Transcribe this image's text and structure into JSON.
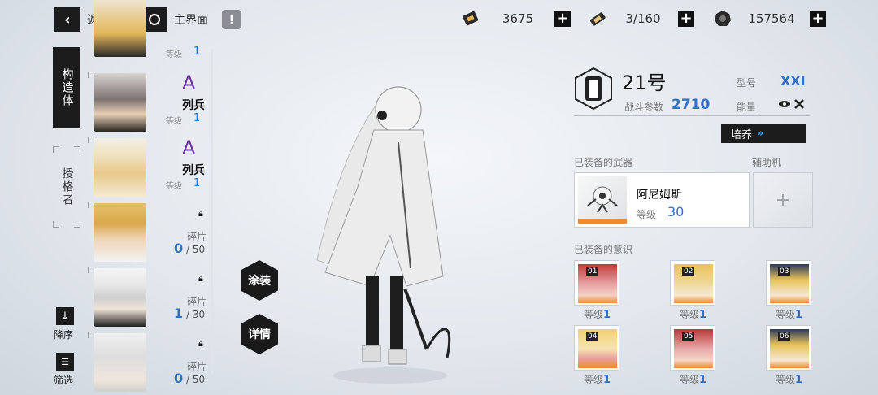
{
  "topbar": {
    "back_label": "返回",
    "main_label": "主界面",
    "info_glyph": "!"
  },
  "resources": [
    {
      "icon": "gold-bar-icon",
      "value": "3675"
    },
    {
      "icon": "stamina-battery-icon",
      "value": "3/160"
    },
    {
      "icon": "cog-coin-icon",
      "value": "157564"
    }
  ],
  "tabs": [
    {
      "label": "构造体",
      "active": true
    },
    {
      "label": "授格者",
      "active": false
    }
  ],
  "characters": [
    {
      "level_label": "等级",
      "level": "1",
      "rank": "",
      "class": "",
      "state": "owned"
    },
    {
      "level_label": "等级",
      "level": "1",
      "rank": "A",
      "class": "列兵",
      "state": "owned"
    },
    {
      "level_label": "等级",
      "level": "1",
      "rank": "A",
      "class": "列兵",
      "state": "owned"
    },
    {
      "shard_label": "碎片",
      "have": "0",
      "need": "50",
      "state": "locked"
    },
    {
      "shard_label": "碎片",
      "have": "1",
      "need": "30",
      "state": "locked"
    },
    {
      "shard_label": "碎片",
      "have": "0",
      "need": "50",
      "state": "locked"
    }
  ],
  "list_controls": {
    "sort_label": "降序",
    "filter_label": "筛选"
  },
  "side_buttons": {
    "coating_label": "涂装",
    "detail_label": "详情"
  },
  "unit": {
    "name": "21号",
    "power_label": "战斗参数",
    "power": "2710",
    "model_label": "型号",
    "model": "XXI",
    "energy_label": "能量",
    "train_label": "培养"
  },
  "weapon": {
    "section_label": "已装备的武器",
    "name": "阿尼姆斯",
    "level_label": "等级",
    "level": "30"
  },
  "support": {
    "section_label": "辅助机"
  },
  "memories": {
    "section_label": "已装备的意识",
    "items": [
      {
        "slot": "01",
        "level_label": "等级",
        "level": "1"
      },
      {
        "slot": "02",
        "level_label": "等级",
        "level": "1"
      },
      {
        "slot": "03",
        "level_label": "等级",
        "level": "1"
      },
      {
        "slot": "04",
        "level_label": "等级",
        "level": "1"
      },
      {
        "slot": "05",
        "level_label": "等级",
        "level": "1"
      },
      {
        "slot": "06",
        "level_label": "等级",
        "level": "1"
      }
    ]
  },
  "colors": {
    "accent_blue": "#2f6fc4",
    "rank_purple": "#6b2fa5",
    "dark": "#1c1c1c"
  }
}
